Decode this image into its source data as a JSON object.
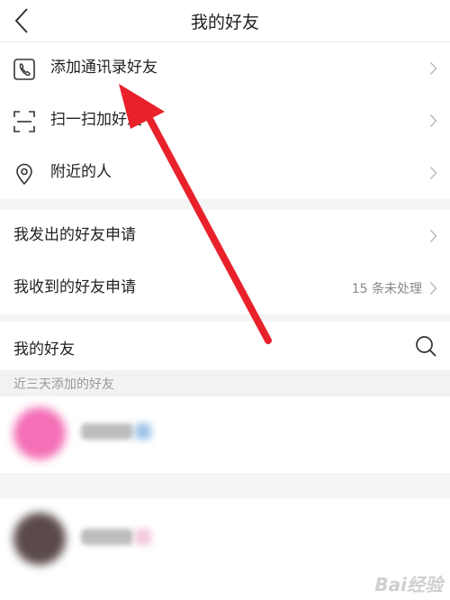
{
  "nav": {
    "title": "我的好友"
  },
  "add_options": [
    {
      "icon": "contact-phone-icon",
      "label": "添加通讯录好友"
    },
    {
      "icon": "scan-icon",
      "label": "扫一扫加好友"
    },
    {
      "icon": "location-pin-icon",
      "label": "附近的人"
    }
  ],
  "requests": {
    "sent_label": "我发出的好友申请",
    "received_label": "我收到的好友申请",
    "received_status": "15 条未处理"
  },
  "friends": {
    "header": "我的好友",
    "section_label": "近三天添加的好友"
  },
  "colors": {
    "annotation_arrow": "#e8212b",
    "avatar_1": "#f46fb6",
    "avatar_2": "#5b4a4a"
  },
  "watermark": "Bai经验"
}
